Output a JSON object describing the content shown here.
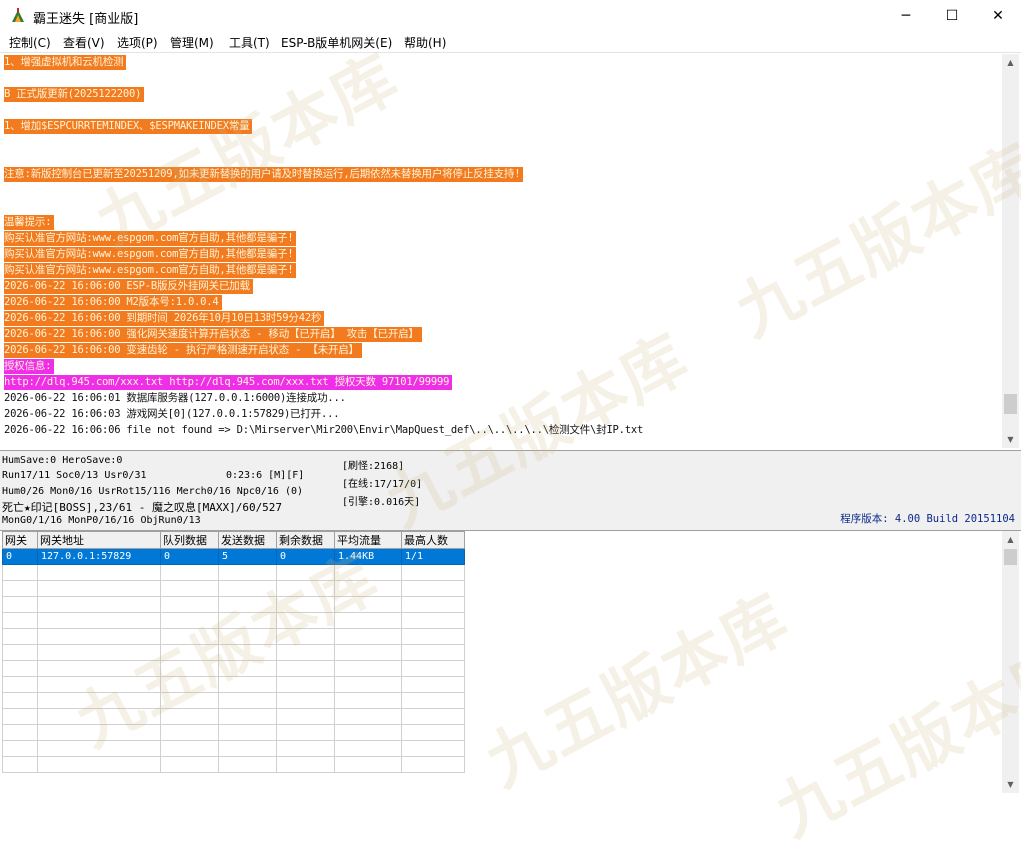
{
  "window": {
    "title": "霸王迷失 [商业版]",
    "min_glyph": "─",
    "max_glyph": "☐",
    "close_glyph": "✕"
  },
  "menu": [
    "控制(C)",
    "查看(V)",
    "选项(P)",
    "管理(M)",
    "工具(T)",
    "ESP-B版单机网关(E)",
    "帮助(H)"
  ],
  "log": [
    {
      "text": "1、增强虚拟机和云机检测",
      "style": "hl-orange"
    },
    {
      "text": "",
      "style": "plain"
    },
    {
      "text": "B 正式版更新(2025122200)",
      "style": "hl-orange"
    },
    {
      "text": "",
      "style": "plain"
    },
    {
      "text": "1、增加$ESPCURRTEMINDEX、$ESPMAKEINDEX常量",
      "style": "hl-orange"
    },
    {
      "text": "",
      "style": "plain"
    },
    {
      "text": "",
      "style": "plain"
    },
    {
      "text": "注意:新版控制台已更新至20251209,如未更新替换的用户请及时替换运行,后期依然未替换用户将停止反挂支持!",
      "style": "hl-orange"
    },
    {
      "text": "",
      "style": "plain"
    },
    {
      "text": "",
      "style": "plain"
    },
    {
      "text": "温馨提示:",
      "style": "hl-orange"
    },
    {
      "text": "购买认准官方网站:www.espgom.com官方自助,其他都是骗子!",
      "style": "hl-orange"
    },
    {
      "text": "购买认准官方网站:www.espgom.com官方自助,其他都是骗子!",
      "style": "hl-orange"
    },
    {
      "text": "购买认准官方网站:www.espgom.com官方自助,其他都是骗子!",
      "style": "hl-orange"
    },
    {
      "text": "2026-06-22 16:06:00 ESP-B版反外挂网关已加载",
      "style": "hl-orange"
    },
    {
      "text": "2026-06-22 16:06:00 M2版本号:1.0.0.4",
      "style": "hl-orange"
    },
    {
      "text": "2026-06-22 16:06:00 到期时间 2026年10月10日13时59分42秒",
      "style": "hl-orange"
    },
    {
      "text": "2026-06-22 16:06:00 强化网关速度计算开启状态 - 移动【已开启】 攻击【已开启】",
      "style": "hl-orange"
    },
    {
      "text": "2026-06-22 16:06:00 变速齿轮 - 执行严格测速开启状态 - 【未开启】",
      "style": "hl-orange"
    },
    {
      "text": "授权信息:",
      "style": "hl-magenta"
    },
    {
      "text": "http://dlq.945.com/xxx.txt http://dlq.945.com/xxx.txt 授权天数 97101/99999",
      "style": "hl-magenta"
    },
    {
      "text": "2026-06-22 16:06:01 数据库服务器(127.0.0.1:6000)连接成功...",
      "style": "plain"
    },
    {
      "text": "2026-06-22 16:06:03 游戏网关[0](127.0.0.1:57829)已打开...",
      "style": "plain"
    },
    {
      "text": "2026-06-22 16:06:06 file not found => D:\\Mirserver\\Mir200\\Envir\\MapQuest_def\\..\\..\\..\\..\\检测文件\\封IP.txt",
      "style": "plain"
    }
  ],
  "status": {
    "line1": "HumSave:0 HeroSave:0",
    "line2": "Run17/11 Soc0/13 Usr0/31",
    "line2_time": "0:23:6 [M][F]",
    "line3": "Hum0/26 Mon0/16 UsrRot15/116 Merch0/16 Npc0/16 (0)",
    "line4": "死亡★印记[BOSS],23/61 - 魔之叹息[MAXX]/60/527",
    "line5": "MonG0/1/16 MonP0/16/16 ObjRun0/13",
    "refresh": "[刷怪:2168]",
    "online": "[在线:17/17/0]",
    "engine": "[引擎:0.016天]",
    "version": "程序版本: 4.00 Build 20151104"
  },
  "grid": {
    "headers": [
      "网关",
      "网关地址",
      "队列数据",
      "发送数据",
      "剩余数据",
      "平均流量",
      "最高人数"
    ],
    "rows": [
      [
        "0",
        "127.0.0.1:57829",
        "0",
        "5",
        "0",
        "1.44KB",
        "1/1"
      ]
    ]
  }
}
